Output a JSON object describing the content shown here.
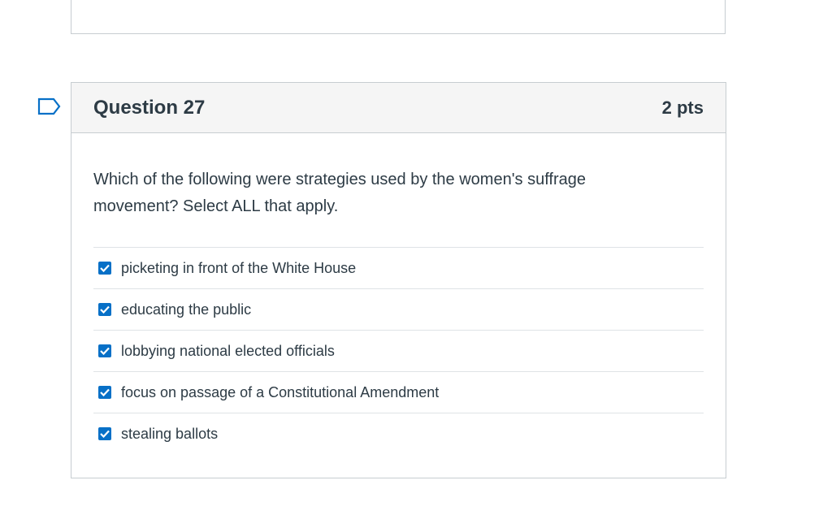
{
  "question": {
    "title": "Question 27",
    "points": "2 pts",
    "text": "Which of the following were strategies used by the women's suffrage movement? Select ALL that apply.",
    "answers": [
      {
        "label": "picketing in front of the White House",
        "checked": true
      },
      {
        "label": "educating the public",
        "checked": true
      },
      {
        "label": "lobbying national elected officials",
        "checked": true
      },
      {
        "label": "focus on passage of a Constitutional Amendment",
        "checked": true
      },
      {
        "label": "stealing ballots",
        "checked": true
      }
    ]
  },
  "colors": {
    "accent": "#0770c7",
    "flag": "#0770c7",
    "text": "#2d3b45",
    "border": "#c7cdd1",
    "header_bg": "#f5f5f5"
  },
  "icons": {
    "flag": "bookmark-flag-icon",
    "checkbox": "checkmark-icon"
  }
}
